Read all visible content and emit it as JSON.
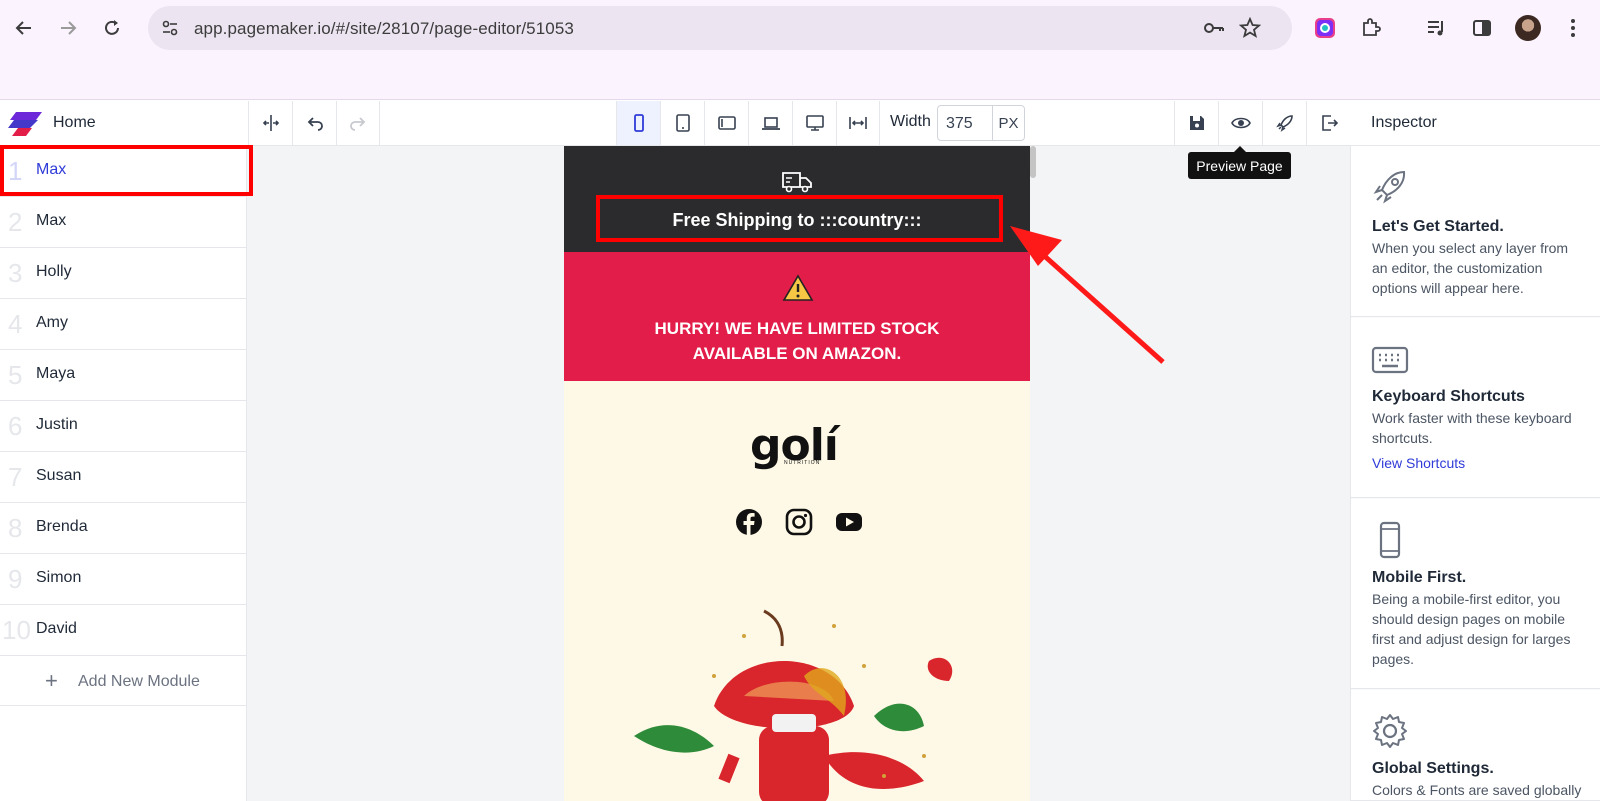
{
  "browser": {
    "url": "app.pagemaker.io/#/site/28107/page-editor/51053"
  },
  "editor": {
    "home_label": "Home",
    "width_label": "Width",
    "width_value": "375",
    "width_unit": "PX",
    "tooltip": "Preview Page",
    "inspector_title": "Inspector"
  },
  "sidebar": {
    "items": [
      {
        "num": "1",
        "name": "Max",
        "active": true
      },
      {
        "num": "2",
        "name": "Max"
      },
      {
        "num": "3",
        "name": "Holly"
      },
      {
        "num": "4",
        "name": "Amy"
      },
      {
        "num": "5",
        "name": "Maya"
      },
      {
        "num": "6",
        "name": "Justin"
      },
      {
        "num": "7",
        "name": "Susan"
      },
      {
        "num": "8",
        "name": "Brenda"
      },
      {
        "num": "9",
        "name": "Simon"
      },
      {
        "num": "10",
        "name": "David"
      }
    ],
    "add_module": "Add New Module"
  },
  "page": {
    "shipping_text": "Free Shipping to :::country:::",
    "hurry_text": "HURRY! WE HAVE LIMITED STOCK AVAILABLE ON AMAZON.",
    "logo_text": "golí",
    "logo_sub": "NUTRITION",
    "social_icons": [
      "facebook-icon",
      "instagram-icon",
      "youtube-icon"
    ]
  },
  "inspector": {
    "cards": [
      {
        "icon": "rocket-icon",
        "title": "Let's Get Started.",
        "text": "When you select any layer from an editor, the customization options will appear here."
      },
      {
        "icon": "keyboard-icon",
        "title": "Keyboard Shortcuts",
        "text": "Work faster with these keyboard shortcuts.",
        "link": "View Shortcuts"
      },
      {
        "icon": "mobile-icon",
        "title": "Mobile First.",
        "text": "Being a mobile-first editor, you should design pages on mobile first and adjust design for larges pages."
      },
      {
        "icon": "gear-icon",
        "title": "Global Settings.",
        "text": "Colors & Fonts are saved globally"
      }
    ]
  },
  "colors": {
    "accent": "#2f3bd8",
    "shipping_bar": "#2b2b2d",
    "hurry_bar": "#e21d4a",
    "page_bg": "#fef9e6",
    "annotation": "#ff0000"
  }
}
